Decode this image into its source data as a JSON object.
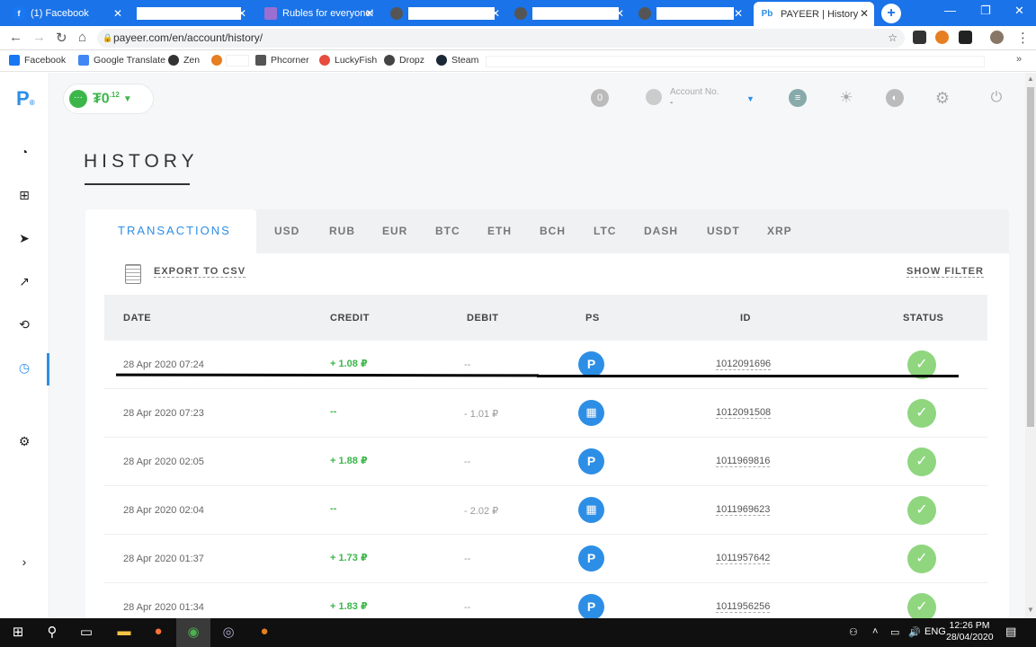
{
  "browser": {
    "tabs": [
      {
        "label": "(1) Facebook",
        "fav": "f",
        "favcolor": "#1877f2"
      },
      {
        "label": "",
        "fav": "",
        "favcolor": "#ffffff",
        "redacted": true
      },
      {
        "label": "Rubles for everyone!",
        "fav": "",
        "favcolor": "#9b6fd1"
      },
      {
        "label": "",
        "fav": "",
        "favcolor": "#555555",
        "redacted": true
      },
      {
        "label": "",
        "fav": "",
        "favcolor": "#555555",
        "redacted": true
      },
      {
        "label": "",
        "fav": "",
        "favcolor": "#555555",
        "redacted": true
      },
      {
        "label": "PAYEER | History",
        "fav": "Pb",
        "favcolor": "#ffffff",
        "active": true
      }
    ],
    "url": "payeer.com/en/account/history/",
    "bookmarks": [
      {
        "label": "Facebook",
        "color": "#1877f2"
      },
      {
        "label": "Google Translate",
        "color": "#4285f4"
      },
      {
        "label": "Zen",
        "color": "#333333"
      },
      {
        "label": "",
        "color": "#e67e22",
        "redacted": true
      },
      {
        "label": "Phcorner",
        "color": "#555555"
      },
      {
        "label": "LuckyFish",
        "color": "#e74c3c"
      },
      {
        "label": "Dropz",
        "color": "#444444"
      },
      {
        "label": "Steam",
        "color": "#1b2838"
      }
    ]
  },
  "app": {
    "balance_amount": "0",
    "balance_decimals": ".12",
    "account_label": "Account No.",
    "account_value": "-",
    "page_title": "HISTORY",
    "tabs": [
      "TRANSACTIONS",
      "USD",
      "RUB",
      "EUR",
      "BTC",
      "ETH",
      "BCH",
      "LTC",
      "DASH",
      "USDT",
      "XRP"
    ],
    "export_label": "EXPORT TO CSV",
    "filter_label": "SHOW FILTER",
    "columns": [
      "DATE",
      "CREDIT",
      "DEBIT",
      "PS",
      "ID",
      "STATUS"
    ],
    "rows": [
      {
        "date": "28 Apr 2020 07:24",
        "credit": "+ 1.08 ₽",
        "debit": "--",
        "ps": "P",
        "id": "1012091696",
        "status": "✓"
      },
      {
        "date": "28 Apr 2020 07:23",
        "credit": "--",
        "debit": "- 1.01 ₽",
        "ps": "shop",
        "id": "1012091508",
        "status": "✓"
      },
      {
        "date": "28 Apr 2020 02:05",
        "credit": "+ 1.88 ₽",
        "debit": "--",
        "ps": "P",
        "id": "1011969816",
        "status": "✓"
      },
      {
        "date": "28 Apr 2020 02:04",
        "credit": "--",
        "debit": "- 2.02 ₽",
        "ps": "shop",
        "id": "1011969623",
        "status": "✓"
      },
      {
        "date": "28 Apr 2020 01:37",
        "credit": "+ 1.73 ₽",
        "debit": "--",
        "ps": "P",
        "id": "1011957642",
        "status": "✓"
      },
      {
        "date": "28 Apr 2020 01:34",
        "credit": "+ 1.83 ₽",
        "debit": "--",
        "ps": "P",
        "id": "1011956256",
        "status": "✓"
      }
    ]
  },
  "taskbar": {
    "lang": "ENG",
    "time": "12:26 PM",
    "date": "28/04/2020"
  }
}
